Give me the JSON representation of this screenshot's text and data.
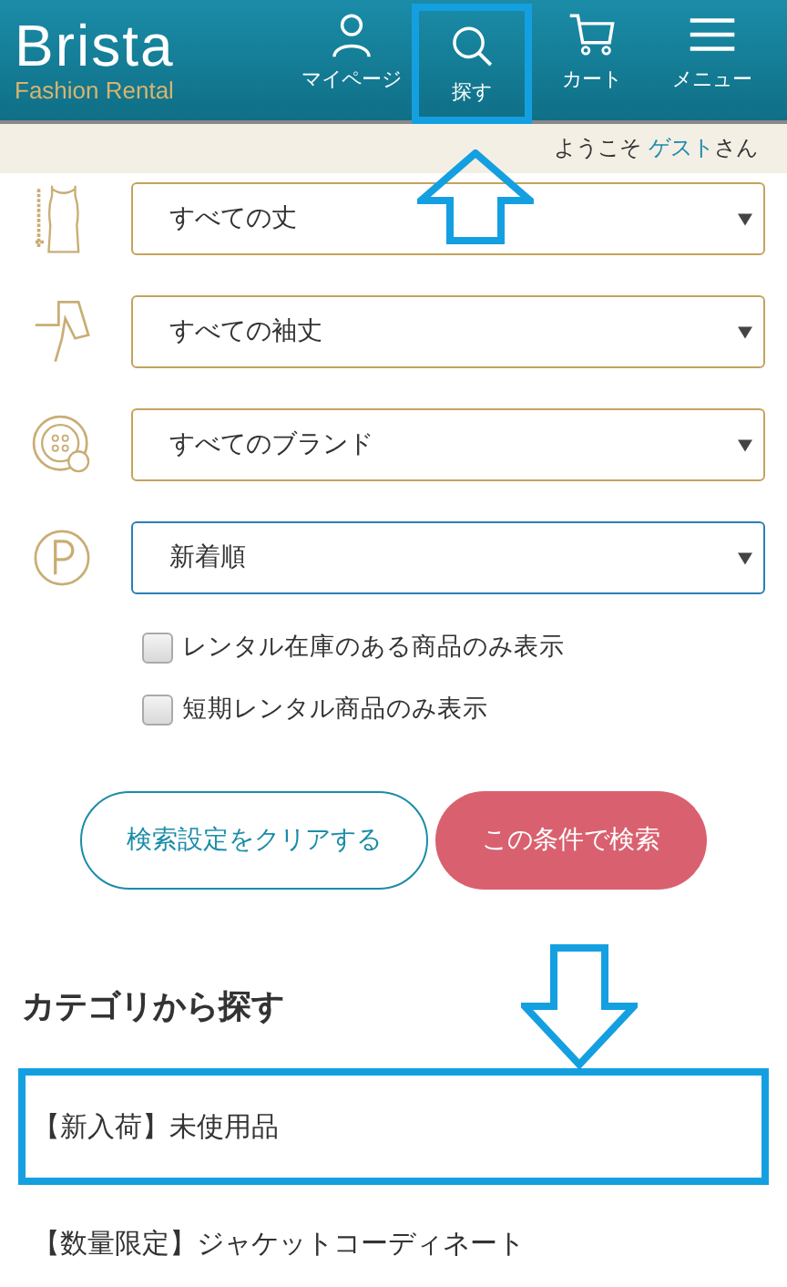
{
  "header": {
    "logo": "Brista",
    "logo_subtitle": "Fashion Rental",
    "nav": [
      {
        "label": "マイページ",
        "kind": "user",
        "annotated": false
      },
      {
        "label": "探す",
        "kind": "search",
        "annotated": true
      },
      {
        "label": "カート",
        "kind": "cart",
        "annotated": false
      },
      {
        "label": "メニュー",
        "kind": "menu",
        "annotated": false
      }
    ]
  },
  "welcome": {
    "prefix": "ようこそ",
    "name": "ゲスト",
    "suffix": "さん"
  },
  "filters": [
    {
      "kind": "dress",
      "value": "すべての丈",
      "focused": false
    },
    {
      "kind": "sleeve",
      "value": "すべての袖丈",
      "focused": false
    },
    {
      "kind": "button",
      "value": "すべてのブランド",
      "focused": false
    },
    {
      "kind": "price",
      "value": "新着順",
      "focused": true
    }
  ],
  "checkboxes": [
    {
      "label": "レンタル在庫のある商品のみ表示",
      "checked": false
    },
    {
      "label": "短期レンタル商品のみ表示",
      "checked": false
    }
  ],
  "buttons": [
    {
      "label": "検索設定をクリアする",
      "kind": "outline"
    },
    {
      "label": "この条件で検索",
      "kind": "primary"
    }
  ],
  "categories": {
    "title": "カテゴリから探す",
    "items": [
      {
        "label": "【新入荷】未使用品",
        "annotated": true
      },
      {
        "label": "【数量限定】ジャケットコーディネート",
        "annotated": false
      }
    ]
  }
}
